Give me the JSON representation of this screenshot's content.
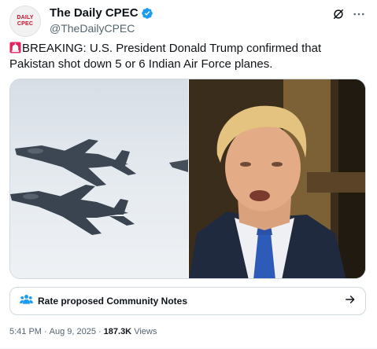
{
  "account": {
    "display_name": "The Daily CPEC",
    "handle": "@TheDailyCPEC",
    "avatar_line1": "DAILY",
    "avatar_line2": "CPEC",
    "verified_icon": "verified-badge-icon",
    "verified_color": "#1d9bf0"
  },
  "header_actions": {
    "grok_icon": "grok-icon",
    "more_icon": "more-options-icon"
  },
  "tweet": {
    "emoji_icon": "police-siren-icon",
    "text": "BREAKING: U.S. President Donald Trump confirmed that Pakistan shot down 5 or 6 Indian Air Force planes."
  },
  "media": {
    "left_image": "fighter-jets-photo",
    "right_image": "donald-trump-photo"
  },
  "community_notes": {
    "icon": "people-icon",
    "label": "Rate proposed Community Notes",
    "arrow_icon": "arrow-right-icon",
    "accent": "#1d9bf0"
  },
  "meta": {
    "time": "5:41 PM",
    "separator": "·",
    "date": "Aug 9, 2025",
    "views_count": "187.3K",
    "views_label": "Views"
  }
}
